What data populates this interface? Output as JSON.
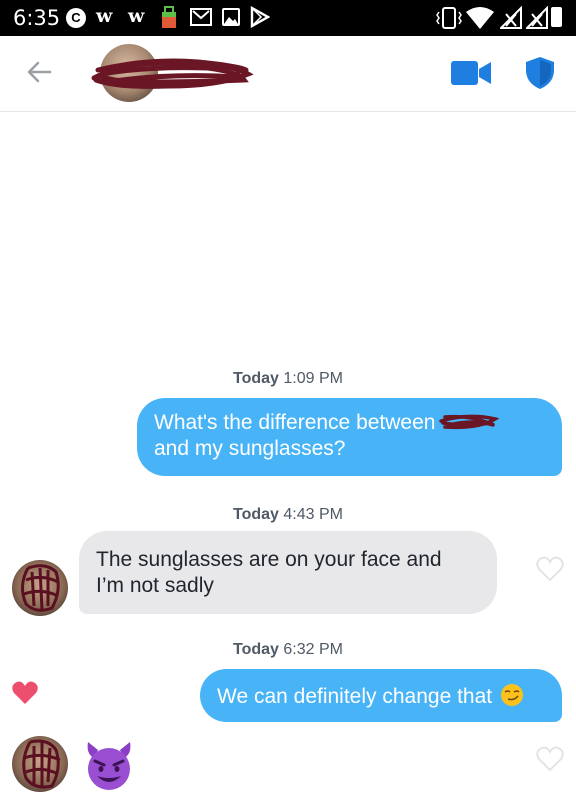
{
  "status_bar": {
    "time": "6:35",
    "icons": [
      "c-app-icon",
      "w-app-icon",
      "w-app-icon",
      "shopping-bag-icon",
      "gmail-icon",
      "image-icon",
      "play-store-icon",
      "vibrate-icon",
      "wifi-icon",
      "no-signal-icon",
      "no-signal-icon",
      "battery-icon"
    ]
  },
  "header": {
    "back_icon": "arrow-left-icon",
    "video_icon": "video-camera-icon",
    "safety_icon": "shield-icon",
    "accent_color": "#1e7fe0"
  },
  "messages": [
    {
      "timestamp_day": "Today",
      "timestamp_time": "1:09 PM",
      "direction": "outgoing",
      "line1": "What's the difference between",
      "line2": "and my sunglasses?"
    },
    {
      "timestamp_day": "Today",
      "timestamp_time": "4:43 PM",
      "direction": "incoming",
      "line1": "The sunglasses are on your face and",
      "line2": "I’m not sadly",
      "liked": false
    },
    {
      "timestamp_day": "Today",
      "timestamp_time": "6:32 PM",
      "direction": "outgoing",
      "line1": "We can definitely change that",
      "emoji": "smirking-face",
      "liked": true
    },
    {
      "direction": "incoming",
      "emoji": "smiling-face-with-horns",
      "liked": false
    }
  ],
  "colors": {
    "outgoing_bubble": "#48b4f7",
    "incoming_bubble": "#e8e8ea",
    "heart_liked": "#ee4e6e",
    "redaction": "#6a1624"
  }
}
